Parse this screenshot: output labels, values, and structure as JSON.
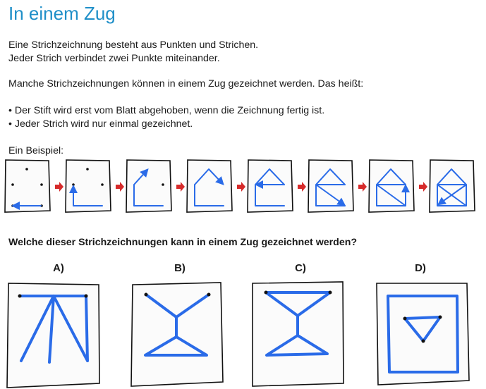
{
  "title": "In einem Zug",
  "intro": {
    "line1": "Eine Strichzeichnung besteht aus Punkten und Strichen.",
    "line2": "Jeder Strich verbindet zwei Punkte miteinander."
  },
  "explanation": "Manche Strichzeichnungen können in einem Zug gezeichnet werden. Das heißt:",
  "rules": [
    "• Der Stift wird erst vom Blatt abgehoben, wenn die Zeichnung fertig ist.",
    "• Jeder Strich wird nur einmal gezeichnet."
  ],
  "example_label": "Ein Beispiel:",
  "question": "Welche dieser Strichzeichnungen kann in einem Zug gezeichnet werden?",
  "options": [
    "A)",
    "B)",
    "C)",
    "D)"
  ],
  "colors": {
    "title": "#1f8fc8",
    "line": "#2a6be8",
    "arrow": "#d62b2b"
  }
}
